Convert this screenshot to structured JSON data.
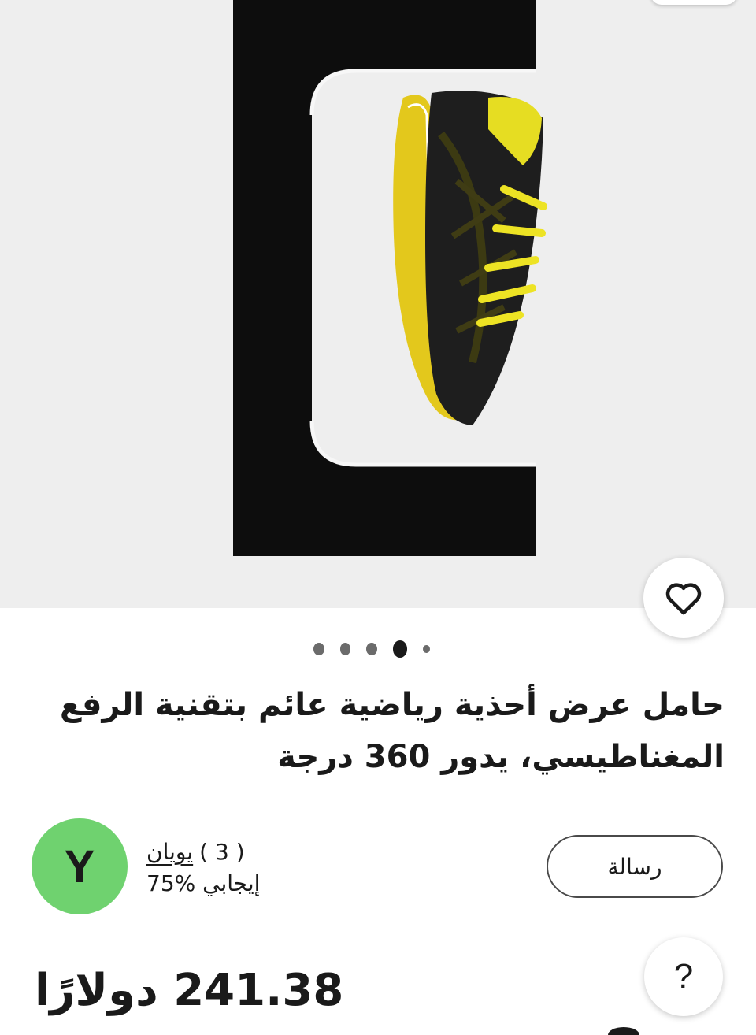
{
  "listing": {
    "title_line1": "حامل عرض أحذية رياضية عائم بتقنية الرفع",
    "title_line2": "المغناطيسي، يدور 360 درجة",
    "price": "241.38 دولارًا"
  },
  "gallery": {
    "dot_count": 5,
    "active_dot_index": 3
  },
  "seller": {
    "avatar_letter": "Y",
    "name": "يويان",
    "review_count": "( 3 )",
    "positive_feedback": "75% إيجابي",
    "avatar_color": "#6fd26f"
  },
  "actions": {
    "message_label": "رسالة",
    "help_label": "?",
    "favorite_icon": "heart-outline-icon"
  }
}
